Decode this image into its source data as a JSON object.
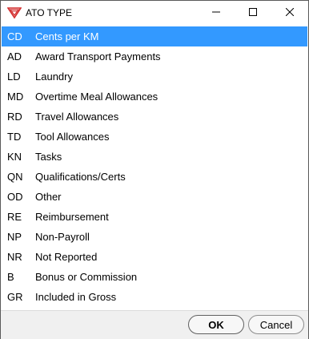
{
  "window": {
    "title": "ATO TYPE"
  },
  "list": {
    "items": [
      {
        "code": "CD",
        "label": "Cents per KM",
        "selected": true
      },
      {
        "code": "AD",
        "label": "Award Transport Payments"
      },
      {
        "code": "LD",
        "label": "Laundry"
      },
      {
        "code": "MD",
        "label": "Overtime Meal Allowances"
      },
      {
        "code": "RD",
        "label": "Travel Allowances"
      },
      {
        "code": "TD",
        "label": "Tool Allowances"
      },
      {
        "code": "KN",
        "label": "Tasks"
      },
      {
        "code": "QN",
        "label": "Qualifications/Certs"
      },
      {
        "code": "OD",
        "label": "Other"
      },
      {
        "code": "RE",
        "label": "Reimbursement"
      },
      {
        "code": "NP",
        "label": "Non-Payroll"
      },
      {
        "code": "NR",
        "label": "Not Reported"
      },
      {
        "code": "B",
        "label": "Bonus or Commission"
      },
      {
        "code": "GR",
        "label": "Included in Gross"
      }
    ]
  },
  "footer": {
    "ok_label": "OK",
    "cancel_label": "Cancel"
  },
  "colors": {
    "selection": "#3399ff",
    "logo_red": "#d32f2f"
  },
  "icons": {
    "app": "app-logo-icon",
    "minimize": "minimize-icon",
    "maximize": "maximize-icon",
    "close": "close-icon"
  }
}
